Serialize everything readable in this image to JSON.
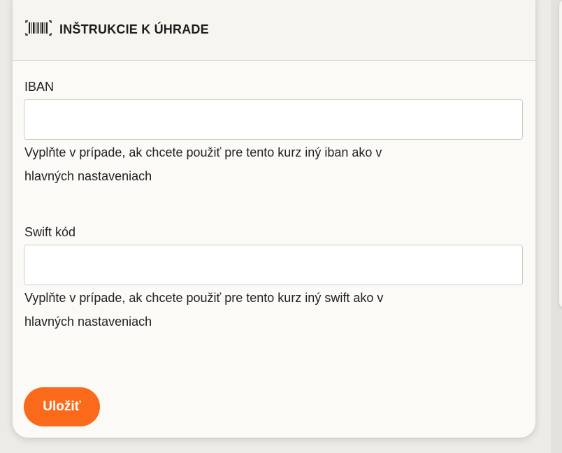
{
  "header": {
    "icon": "barcode-icon",
    "title": "INŠTRUKCIE K ÚHRADE"
  },
  "fields": {
    "iban": {
      "label": "IBAN",
      "value": "",
      "help_line1": "Vyplňte v prípade, ak chcete použiť pre tento kurz iný iban ako v",
      "help_line2": "hlavných nastaveniach"
    },
    "swift": {
      "label": "Swift kód",
      "value": "",
      "help_line1": "Vyplňte v prípade, ak chcete použiť pre tento kurz iný swift ako v",
      "help_line2": "hlavných nastaveniach"
    }
  },
  "actions": {
    "save_label": "Uložiť"
  },
  "colors": {
    "accent": "#fb6a1a",
    "card_background": "#fbfaf7",
    "page_background": "#ecebe6"
  }
}
